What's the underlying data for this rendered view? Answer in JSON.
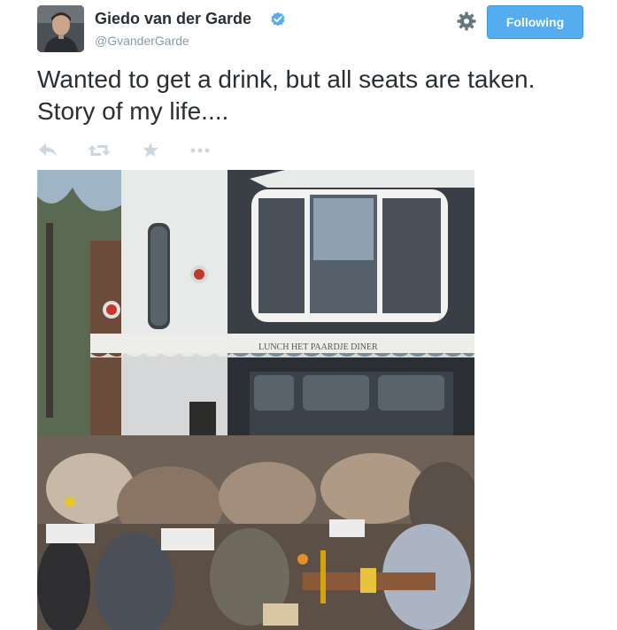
{
  "author": {
    "name": "Giedo van der Garde",
    "handle": "@GvanderGarde",
    "verified": true,
    "avatar_icon": "profile-photo"
  },
  "header": {
    "settings_icon": "gear-icon",
    "follow_button_label": "Following",
    "follow_button_color": "#55acee"
  },
  "tweet": {
    "text": "Wanted to get a drink, but all seats are taken. Story of my life...."
  },
  "actions": [
    {
      "icon": "reply-icon"
    },
    {
      "icon": "retweet-icon"
    },
    {
      "icon": "favorite-star-icon"
    },
    {
      "icon": "more-dots-icon"
    }
  ],
  "photo": {
    "sign_text": "LUNCH  HET PAARDJE  DINER"
  },
  "colors": {
    "text": "#292f33",
    "secondary_text": "#8899a6",
    "action_icons": "#ccd6dd",
    "verified_badge": "#55acee"
  }
}
